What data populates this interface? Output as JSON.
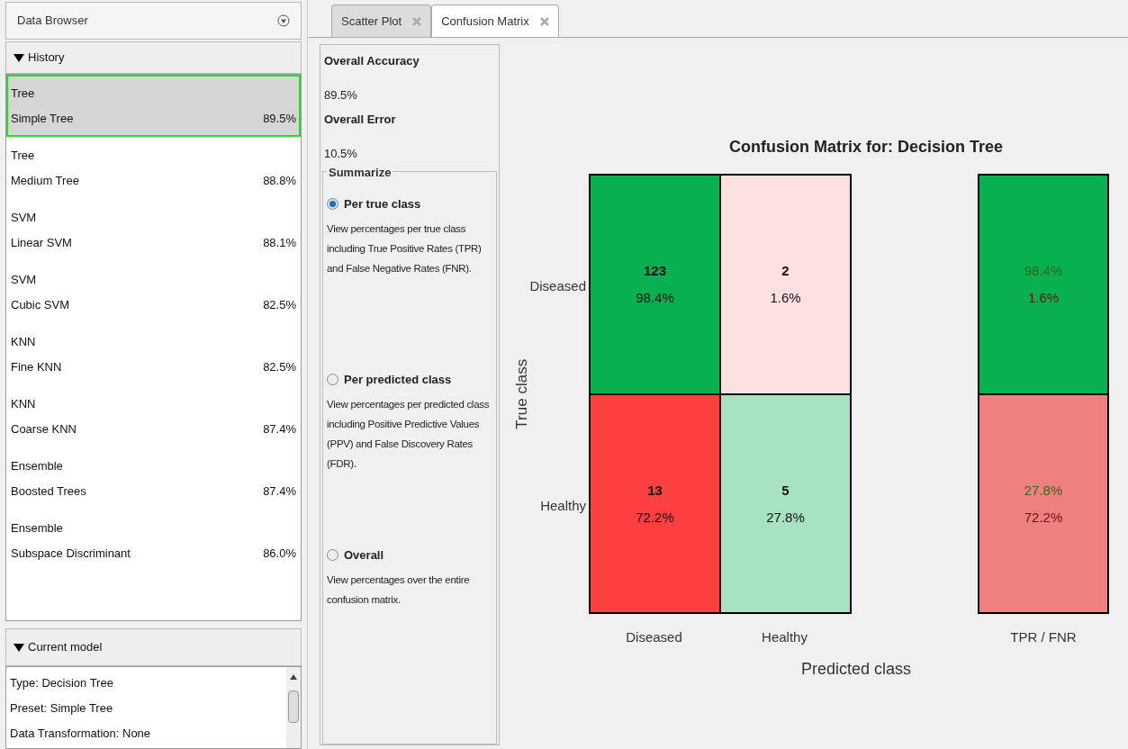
{
  "data_browser": {
    "title": "Data Browser"
  },
  "history": {
    "title": "History",
    "expanded": true,
    "items": [
      {
        "type": "Tree",
        "name": "Simple Tree",
        "accuracy": "89.5%",
        "selected": true
      },
      {
        "type": "Tree",
        "name": "Medium Tree",
        "accuracy": "88.8%",
        "selected": false
      },
      {
        "type": "SVM",
        "name": "Linear SVM",
        "accuracy": "88.1%",
        "selected": false
      },
      {
        "type": "SVM",
        "name": "Cubic SVM",
        "accuracy": "82.5%",
        "selected": false
      },
      {
        "type": "KNN",
        "name": "Fine KNN",
        "accuracy": "82.5%",
        "selected": false
      },
      {
        "type": "KNN",
        "name": "Coarse KNN",
        "accuracy": "87.4%",
        "selected": false
      },
      {
        "type": "Ensemble",
        "name": "Boosted Trees",
        "accuracy": "87.4%",
        "selected": false
      },
      {
        "type": "Ensemble",
        "name": "Subspace Discriminant",
        "accuracy": "86.0%",
        "selected": false
      }
    ]
  },
  "current_model": {
    "title": "Current model",
    "expanded": true,
    "lines": [
      "Type: Decision Tree",
      "Preset: Simple Tree",
      "Data Transformation: None"
    ]
  },
  "tabs": [
    {
      "label": "Scatter Plot",
      "selected": false
    },
    {
      "label": "Confusion Matrix",
      "selected": true
    }
  ],
  "stats": [
    {
      "label": "Overall Accuracy",
      "value": "89.5%"
    },
    {
      "label": "Overall Error",
      "value": "10.5%"
    }
  ],
  "summarize": {
    "title": "Summarize",
    "options": [
      {
        "label": "Per true class",
        "description": "View percentages per true class including True Positive Rates (TPR) and False Negative Rates (FNR).",
        "selected": true
      },
      {
        "label": "Per predicted class",
        "description": "View percentages per predicted class including Positive Predictive Values (PPV) and False Discovery Rates (FDR).",
        "selected": false
      },
      {
        "label": "Overall",
        "description": "View percentages over the entire confusion matrix.",
        "selected": false
      }
    ]
  },
  "matrix": {
    "title": "Confusion Matrix for: Decision Tree",
    "ylabel": "True class",
    "xlabel": "Predicted class",
    "row_labels": [
      "Diseased",
      "Healthy"
    ],
    "column_labels": [
      "Diseased",
      "Healthy"
    ],
    "rows": [
      [
        {
          "count": "123",
          "percent": "98.4%",
          "color": "#08b050"
        },
        {
          "count": "2",
          "percent": "1.6%",
          "color": "#fde0e0"
        }
      ],
      [
        {
          "count": "13",
          "percent": "72.2%",
          "color": "#fc4040"
        },
        {
          "count": "5",
          "percent": "27.8%",
          "color": "#a7e3c1"
        }
      ]
    ],
    "summary_label": "TPR / FNR",
    "summary": [
      {
        "tpr": "98.4%",
        "fnr": "1.6%",
        "color": "#08b050"
      },
      {
        "tpr": "27.8%",
        "fnr": "72.2%",
        "color": "#f08080"
      }
    ]
  }
}
